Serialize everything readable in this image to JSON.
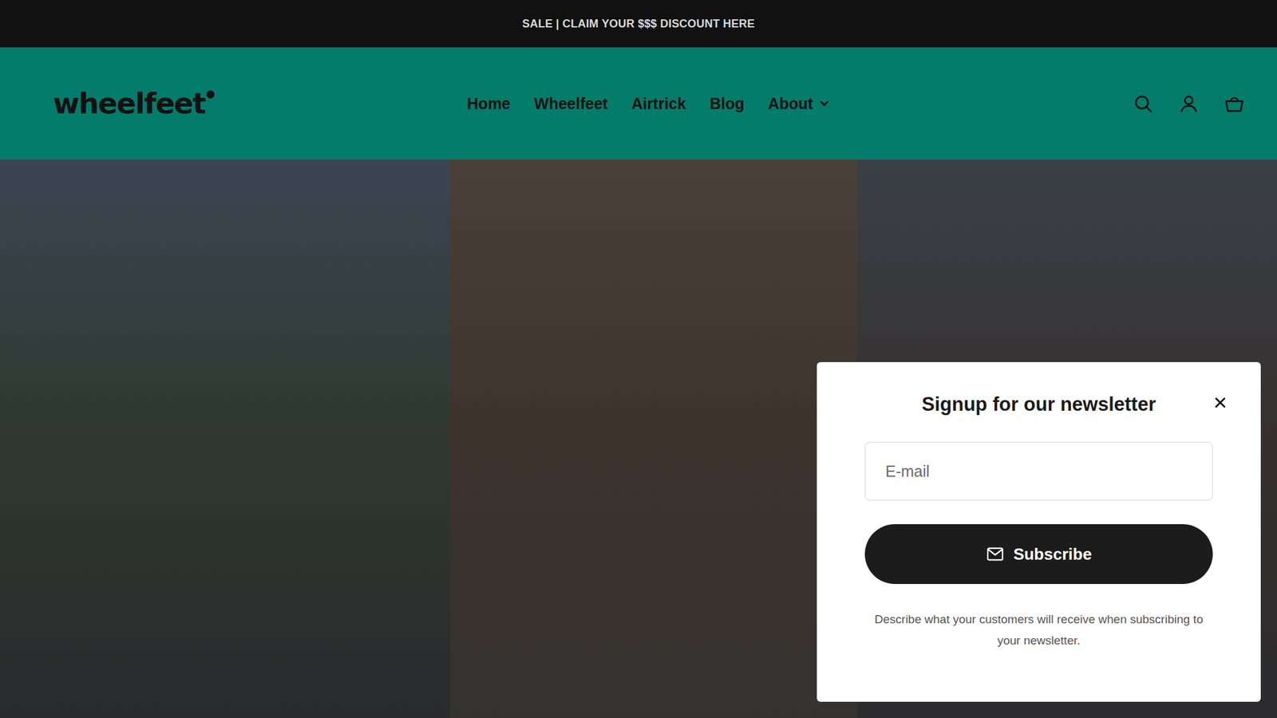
{
  "announcement": "SALE | CLAIM YOUR $$$ DISCOUNT HERE",
  "header": {
    "logo": "wheelfeet",
    "nav": [
      {
        "label": "Home",
        "dropdown": false
      },
      {
        "label": "Wheelfeet",
        "dropdown": false
      },
      {
        "label": "Airtrick",
        "dropdown": false
      },
      {
        "label": "Blog",
        "dropdown": false
      },
      {
        "label": "About",
        "dropdown": true
      }
    ]
  },
  "popup": {
    "title": "Signup for our newsletter",
    "email_placeholder": "E-mail",
    "button": "Subscribe",
    "description": "Describe what your customers will receive when subscribing to your newsletter."
  }
}
